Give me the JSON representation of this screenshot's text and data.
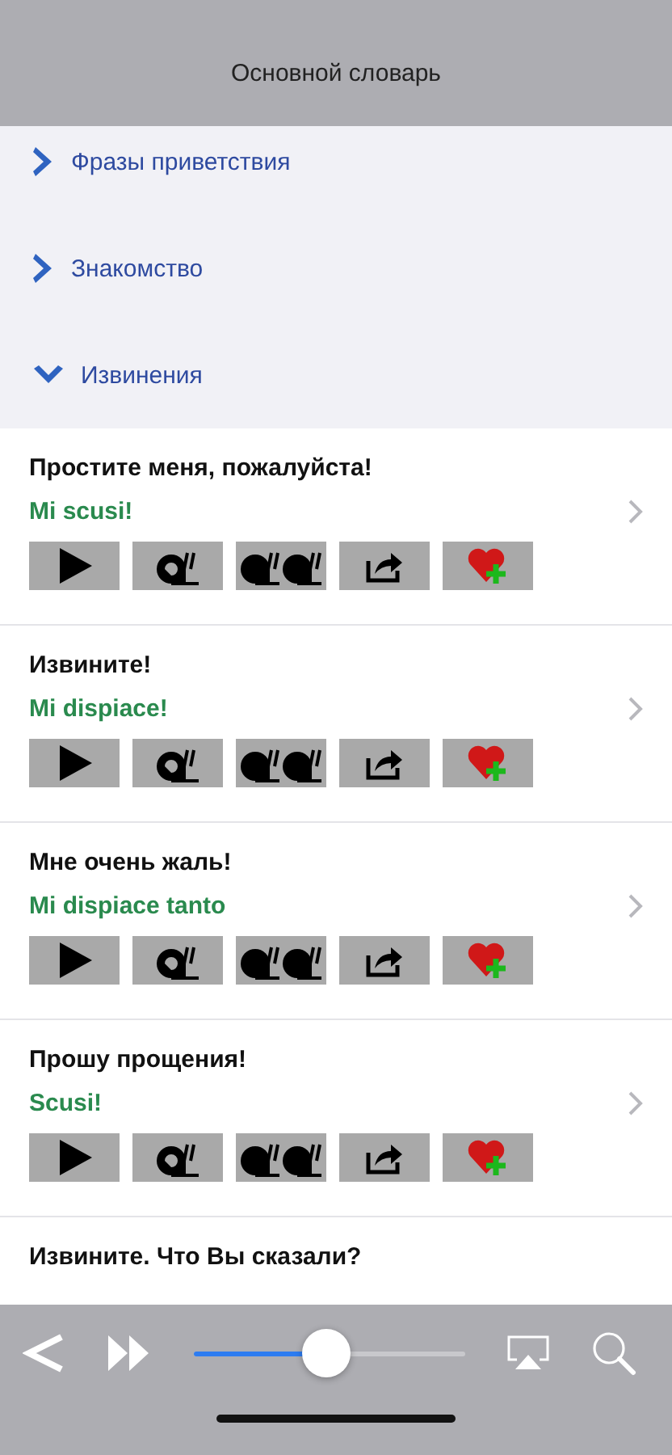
{
  "header": {
    "title": "Основной словарь"
  },
  "categories": [
    {
      "label": "Фразы приветствия",
      "expanded": false
    },
    {
      "label": "Знакомство",
      "expanded": false
    },
    {
      "label": "Извинения",
      "expanded": true
    }
  ],
  "phrases": [
    {
      "russian": "Простите меня, пожалуйста!",
      "italian": "Mi scusi!"
    },
    {
      "russian": "Извините!",
      "italian": "Mi dispiace!"
    },
    {
      "russian": "Мне очень жаль!",
      "italian": "Mi dispiace tanto"
    },
    {
      "russian": "Прошу прощения!",
      "italian": "Scusi!"
    },
    {
      "russian": "Извините. Что Вы сказали?"
    }
  ],
  "player": {
    "level": 0.49
  }
}
